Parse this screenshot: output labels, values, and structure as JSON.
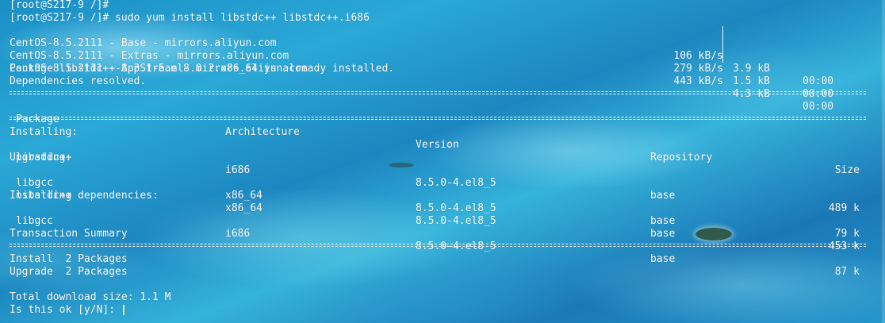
{
  "lines": {
    "prompt1": "[root@S217-9 /]#",
    "prompt2": "[root@S217-9 /]# sudo yum install libstdc++ libstdc++.i686",
    "installed_msg": "Package libstdc++-8.3.1-5.el8.0.2.x86_64 is already installed.",
    "deps_resolved": "Dependencies resolved."
  },
  "repos": [
    {
      "name": "CentOS-8.5.2111 - Base - mirrors.aliyun.com",
      "speed": "106 kB/s",
      "size": "3.9 kB",
      "time": "00:00"
    },
    {
      "name": "CentOS-8.5.2111 - Extras - mirrors.aliyun.com",
      "speed": "279 kB/s",
      "size": "1.5 kB",
      "time": "00:00"
    },
    {
      "name": "CentOS-8.5.2111 - AppStream - mirrors.aliyun.com",
      "speed": "443 kB/s",
      "size": "4.3 kB",
      "time": "00:00"
    }
  ],
  "table": {
    "headers": {
      "package": "Package",
      "arch": "Architecture",
      "version": "Version",
      "repo": "Repository",
      "size": "Size"
    },
    "groups": {
      "installing": "Installing:",
      "upgrading": "Upgrading:",
      "deps": "Installing dependencies:"
    },
    "rows": [
      {
        "package": "libstdc++",
        "arch": "i686",
        "version": "8.5.0-4.el8_5",
        "repo": "base",
        "size": "489 k"
      },
      {
        "package": "libgcc",
        "arch": "x86_64",
        "version": "8.5.0-4.el8_5",
        "repo": "base",
        "size": "79 k"
      },
      {
        "package": "libstdc++",
        "arch": "x86_64",
        "version": "8.5.0-4.el8_5",
        "repo": "base",
        "size": "453 k"
      },
      {
        "package": "libgcc",
        "arch": "i686",
        "version": "8.5.0-4.el8_5",
        "repo": "base",
        "size": "87 k"
      }
    ]
  },
  "summary": {
    "title": "Transaction Summary",
    "install": "Install  2 Packages",
    "upgrade": "Upgrade  2 Packages",
    "download": "Total download size: 1.1 M",
    "confirm": "Is this ok [y/N]: "
  },
  "colors": {
    "text": "#ffffff",
    "cursor": "#ffe76a",
    "background": "#1f93c9"
  }
}
